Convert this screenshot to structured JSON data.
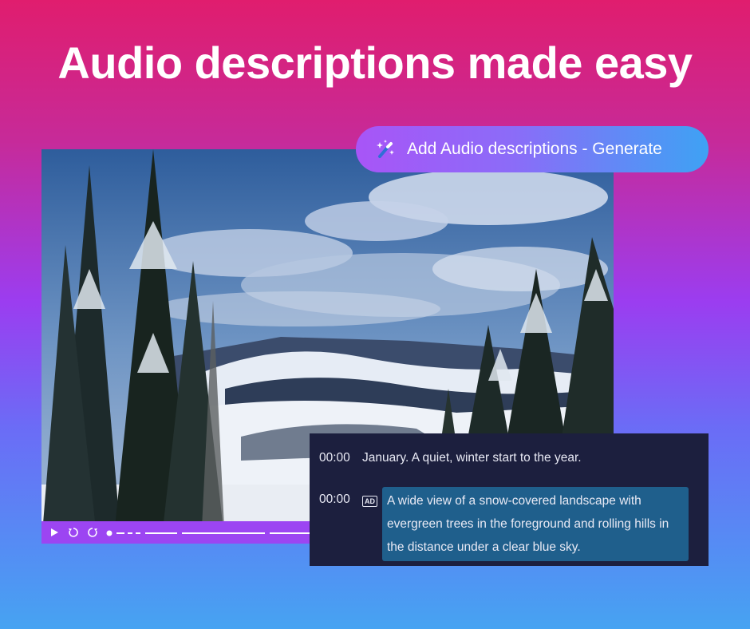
{
  "headline": "Audio descriptions made easy",
  "generate_button": {
    "label": "Add Audio descriptions - Generate",
    "icon": "magic-wand-icon"
  },
  "player": {
    "icons": [
      "play-icon",
      "rewind-icon",
      "forward-icon"
    ]
  },
  "captions": [
    {
      "time": "00:00",
      "text": "January. A quiet, winter start to the year.",
      "is_audio_description": false
    },
    {
      "time": "00:00",
      "badge": "AD",
      "text": "A wide view of a snow-covered landscape with evergreen trees in the foreground and rolling hills in the distance under a clear blue sky.",
      "is_audio_description": true
    }
  ],
  "colors": {
    "gradient_top": "#e01d6e",
    "gradient_mid": "#9b3df0",
    "gradient_bottom": "#46a3f2",
    "control_bar": "#9c45f2",
    "panel_bg": "#1c1f3e",
    "highlight_bg": "#1f5f8c"
  }
}
